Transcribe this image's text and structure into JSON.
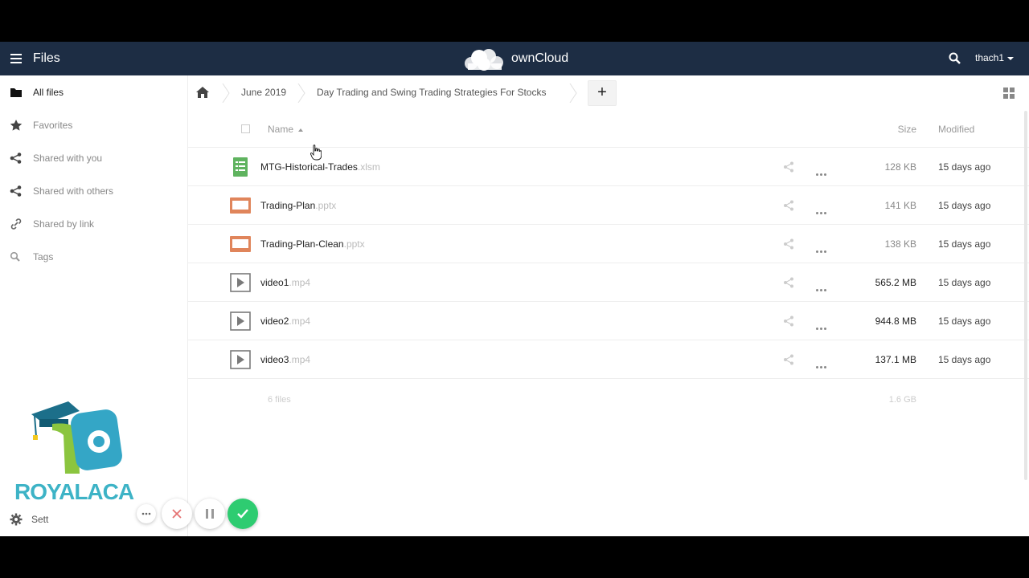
{
  "header": {
    "app_title": "Files",
    "brand": "ownCloud",
    "user": "thach1",
    "menu_icon": "hamburger-menu-icon",
    "search_icon": "search-icon"
  },
  "sidebar": {
    "items": [
      {
        "label": "All files",
        "icon": "folder-icon",
        "active": true
      },
      {
        "label": "Favorites",
        "icon": "star-icon",
        "active": false
      },
      {
        "label": "Shared with you",
        "icon": "share-icon",
        "active": false
      },
      {
        "label": "Shared with others",
        "icon": "share-icon",
        "active": false
      },
      {
        "label": "Shared by link",
        "icon": "link-icon",
        "active": false
      },
      {
        "label": "Tags",
        "icon": "tag-search-icon",
        "active": false
      }
    ],
    "settings_label": "Sett",
    "watermark_text": "ROYALACA"
  },
  "breadcrumb": {
    "items": [
      "June 2019",
      "Day Trading and Swing Trading Strategies For Stocks"
    ],
    "new_label": "+"
  },
  "table": {
    "headers": {
      "name": "Name",
      "size": "Size",
      "modified": "Modified"
    },
    "rows": [
      {
        "name": "MTG-Historical-Trades",
        "ext": ".xlsm",
        "type": "spreadsheet",
        "size": "128 KB",
        "modified": "15 days ago"
      },
      {
        "name": "Trading-Plan",
        "ext": ".pptx",
        "type": "presentation",
        "size": "141 KB",
        "modified": "15 days ago"
      },
      {
        "name": "Trading-Plan-Clean",
        "ext": ".pptx",
        "type": "presentation",
        "size": "138 KB",
        "modified": "15 days ago"
      },
      {
        "name": "video1",
        "ext": ".mp4",
        "type": "video",
        "size": "565.2 MB",
        "modified": "15 days ago"
      },
      {
        "name": "video2",
        "ext": ".mp4",
        "type": "video",
        "size": "944.8 MB",
        "modified": "15 days ago"
      },
      {
        "name": "video3",
        "ext": ".mp4",
        "type": "video",
        "size": "137.1 MB",
        "modified": "15 days ago"
      }
    ],
    "summary": {
      "count": "6 files",
      "total": "1.6 GB"
    }
  },
  "colors": {
    "header_bg": "#1d2d44",
    "spreadsheet": "#5fb35f",
    "presentation": "#e0855b",
    "video": "#7a7a7a",
    "confirm": "#2ecc71"
  }
}
